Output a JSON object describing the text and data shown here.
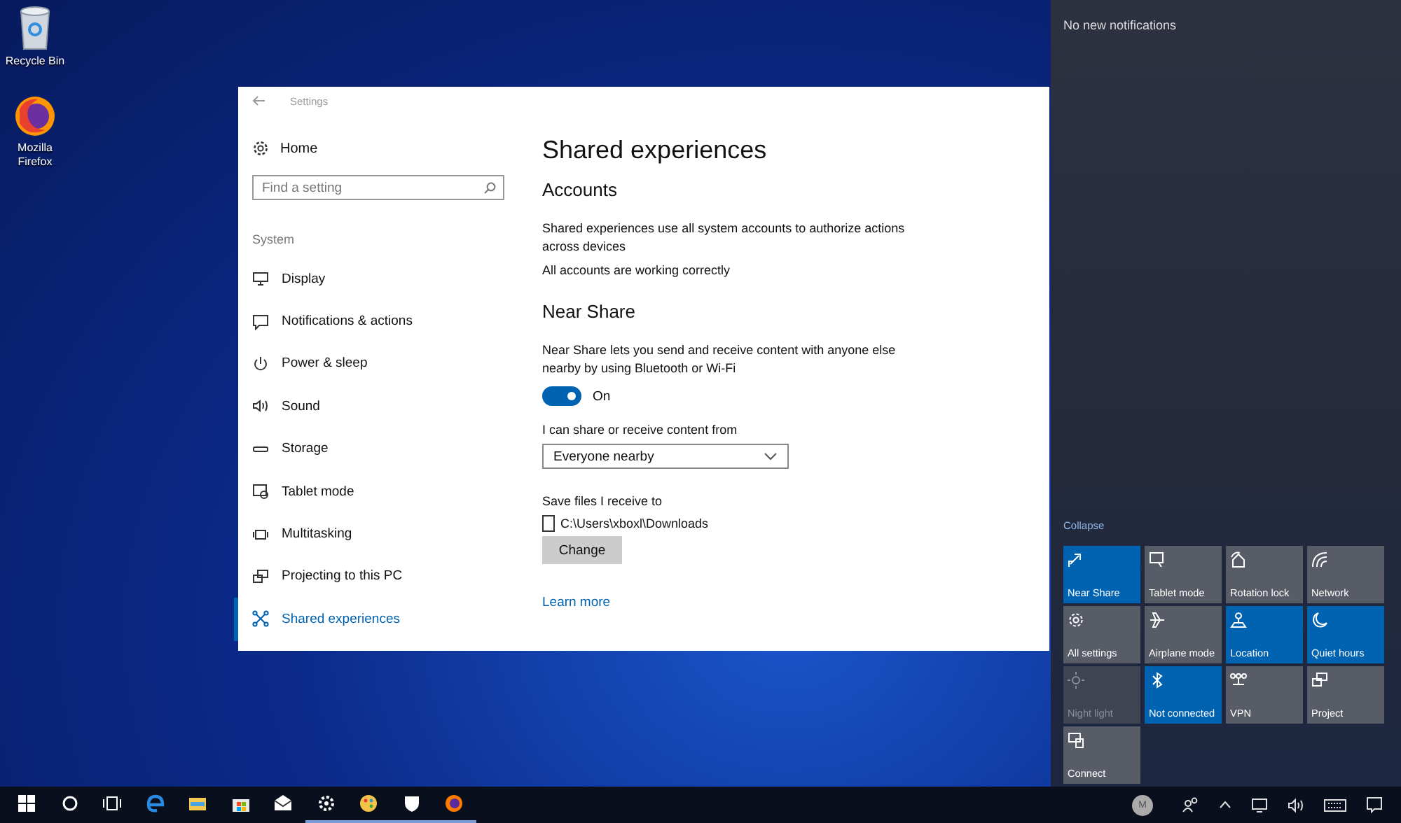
{
  "desktop_icons": [
    {
      "label": "Recycle Bin"
    },
    {
      "label": "Mozilla Firefox"
    }
  ],
  "settings": {
    "title": "Settings",
    "home": "Home",
    "search": {
      "placeholder": "Find a setting"
    },
    "section": "System",
    "nav": [
      {
        "label": "Display",
        "selected": false
      },
      {
        "label": "Notifications & actions",
        "selected": false
      },
      {
        "label": "Power & sleep",
        "selected": false
      },
      {
        "label": "Sound",
        "selected": false
      },
      {
        "label": "Storage",
        "selected": false
      },
      {
        "label": "Tablet mode",
        "selected": false
      },
      {
        "label": "Multitasking",
        "selected": false
      },
      {
        "label": "Projecting to this PC",
        "selected": false
      },
      {
        "label": "Shared experiences",
        "selected": true
      }
    ],
    "page_title": "Shared experiences",
    "accounts": {
      "heading": "Accounts",
      "description": "Shared experiences use all system accounts to authorize actions across devices",
      "status": "All accounts are working correctly"
    },
    "near_share": {
      "heading": "Near Share",
      "description": "Near Share lets you send and receive content with anyone else nearby by using Bluetooth or Wi-Fi",
      "toggle": {
        "on": true,
        "label": "On"
      },
      "share_from_label": "I can share or receive content from",
      "share_from": {
        "value": "Everyone nearby"
      },
      "save_label": "Save files I receive to",
      "save_path": "C:\\Users\\xboxl\\Downloads",
      "change_button": "Change"
    },
    "learn_more": "Learn more"
  },
  "action_center": {
    "notifications": "No new notifications",
    "collapse": "Collapse",
    "tiles": [
      {
        "label": "Near Share",
        "on": true,
        "disabled": false
      },
      {
        "label": "Tablet mode",
        "on": false,
        "disabled": false
      },
      {
        "label": "Rotation lock",
        "on": false,
        "disabled": false
      },
      {
        "label": "Network",
        "on": false,
        "disabled": false
      },
      {
        "label": "All settings",
        "on": false,
        "disabled": false
      },
      {
        "label": "Airplane mode",
        "on": false,
        "disabled": false
      },
      {
        "label": "Location",
        "on": true,
        "disabled": false
      },
      {
        "label": "Quiet hours",
        "on": true,
        "disabled": false
      },
      {
        "label": "Night light",
        "on": false,
        "disabled": true
      },
      {
        "label": "Not connected",
        "on": true,
        "disabled": false
      },
      {
        "label": "VPN",
        "on": false,
        "disabled": false
      },
      {
        "label": "Project",
        "on": false,
        "disabled": false
      },
      {
        "label": "Connect",
        "on": false,
        "disabled": false
      }
    ]
  },
  "taskbar": {
    "apps": [
      {
        "running": false
      },
      {
        "running": false
      },
      {
        "running": false
      },
      {
        "running": false
      },
      {
        "running": false
      },
      {
        "running": false
      },
      {
        "running": false
      },
      {
        "running": true
      },
      {
        "running": true
      },
      {
        "running": true
      },
      {
        "running": true
      }
    ],
    "avatar": "M"
  }
}
